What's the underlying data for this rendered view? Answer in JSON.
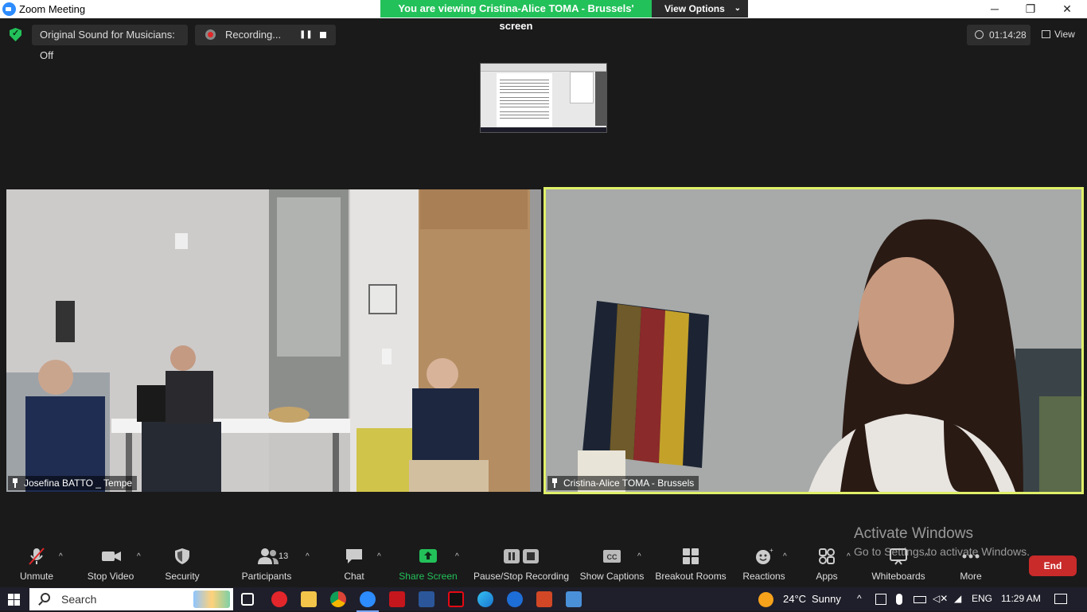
{
  "window": {
    "title": "Zoom Meeting",
    "share_banner": "You are viewing Cristina-Alice TOMA - Brussels' screen",
    "view_options": "View Options",
    "controls": {
      "minimize": "─",
      "restore": "❐",
      "close": "✕"
    }
  },
  "topbar": {
    "original_sound": "Original Sound for Musicians: Off",
    "recording_label": "Recording...",
    "timer": "01:14:28",
    "view": "View"
  },
  "participants": [
    {
      "name": "Josefina BATTO _ Tempe"
    },
    {
      "name": "Cristina-Alice TOMA - Brussels"
    }
  ],
  "watermark": {
    "line1": "Activate Windows",
    "line2": "Go to Settings to activate Windows."
  },
  "toolbar": {
    "unmute": "Unmute",
    "stop_video": "Stop Video",
    "security": "Security",
    "participants": "Participants",
    "participants_count": "13",
    "chat": "Chat",
    "share_screen": "Share Screen",
    "pause_stop_recording": "Pause/Stop Recording",
    "show_captions": "Show Captions",
    "breakout_rooms": "Breakout Rooms",
    "reactions": "Reactions",
    "apps": "Apps",
    "whiteboards": "Whiteboards",
    "more": "More",
    "end": "End",
    "captions_icon_text": "CC"
  },
  "taskbar": {
    "search": "Search",
    "weather_temp": "24°C",
    "weather_desc": "Sunny",
    "language": "ENG",
    "time": "11:29 AM"
  },
  "colors": {
    "share_green": "#23c15a",
    "active_speaker_border": "#e0f069",
    "end_red": "#c92a2a",
    "zoom_blue": "#2d8cff"
  }
}
